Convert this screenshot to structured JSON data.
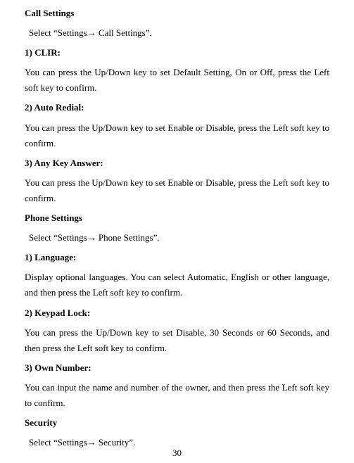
{
  "sections": [
    {
      "heading": "Call Settings",
      "nav": "Select “Settings→ Call Settings”.",
      "items": [
        {
          "title": "1) CLIR:",
          "body": "You can press the Up/Down key to set Default Setting, On or Off, press the Left soft key to confirm."
        },
        {
          "title": "2) Auto Redial:",
          "body": "You can press the Up/Down key to set Enable or Disable, press the Left soft key to confirm."
        },
        {
          "title": "3) Any Key Answer:",
          "body": "You can press the Up/Down key to set Enable or Disable, press the Left soft key to confirm."
        }
      ]
    },
    {
      "heading": "Phone Settings",
      "nav": "Select “Settings→ Phone Settings”.",
      "items": [
        {
          "title": "1) Language:",
          "body": "Display optional languages. You can select Automatic, English or other language, and then press the Left soft key to confirm."
        },
        {
          "title": "2) Keypad Lock:",
          "body": "You can press the Up/Down key to set Disable, 30 Seconds or 60 Seconds, and then press the Left soft key to confirm."
        },
        {
          "title": "3) Own Number:",
          "body": "You can input the name and number of the owner, and then press the Left soft key to confirm."
        }
      ]
    },
    {
      "heading": "Security",
      "nav": "Select “Settings→ Security”.",
      "items": []
    }
  ],
  "page_number": "30"
}
